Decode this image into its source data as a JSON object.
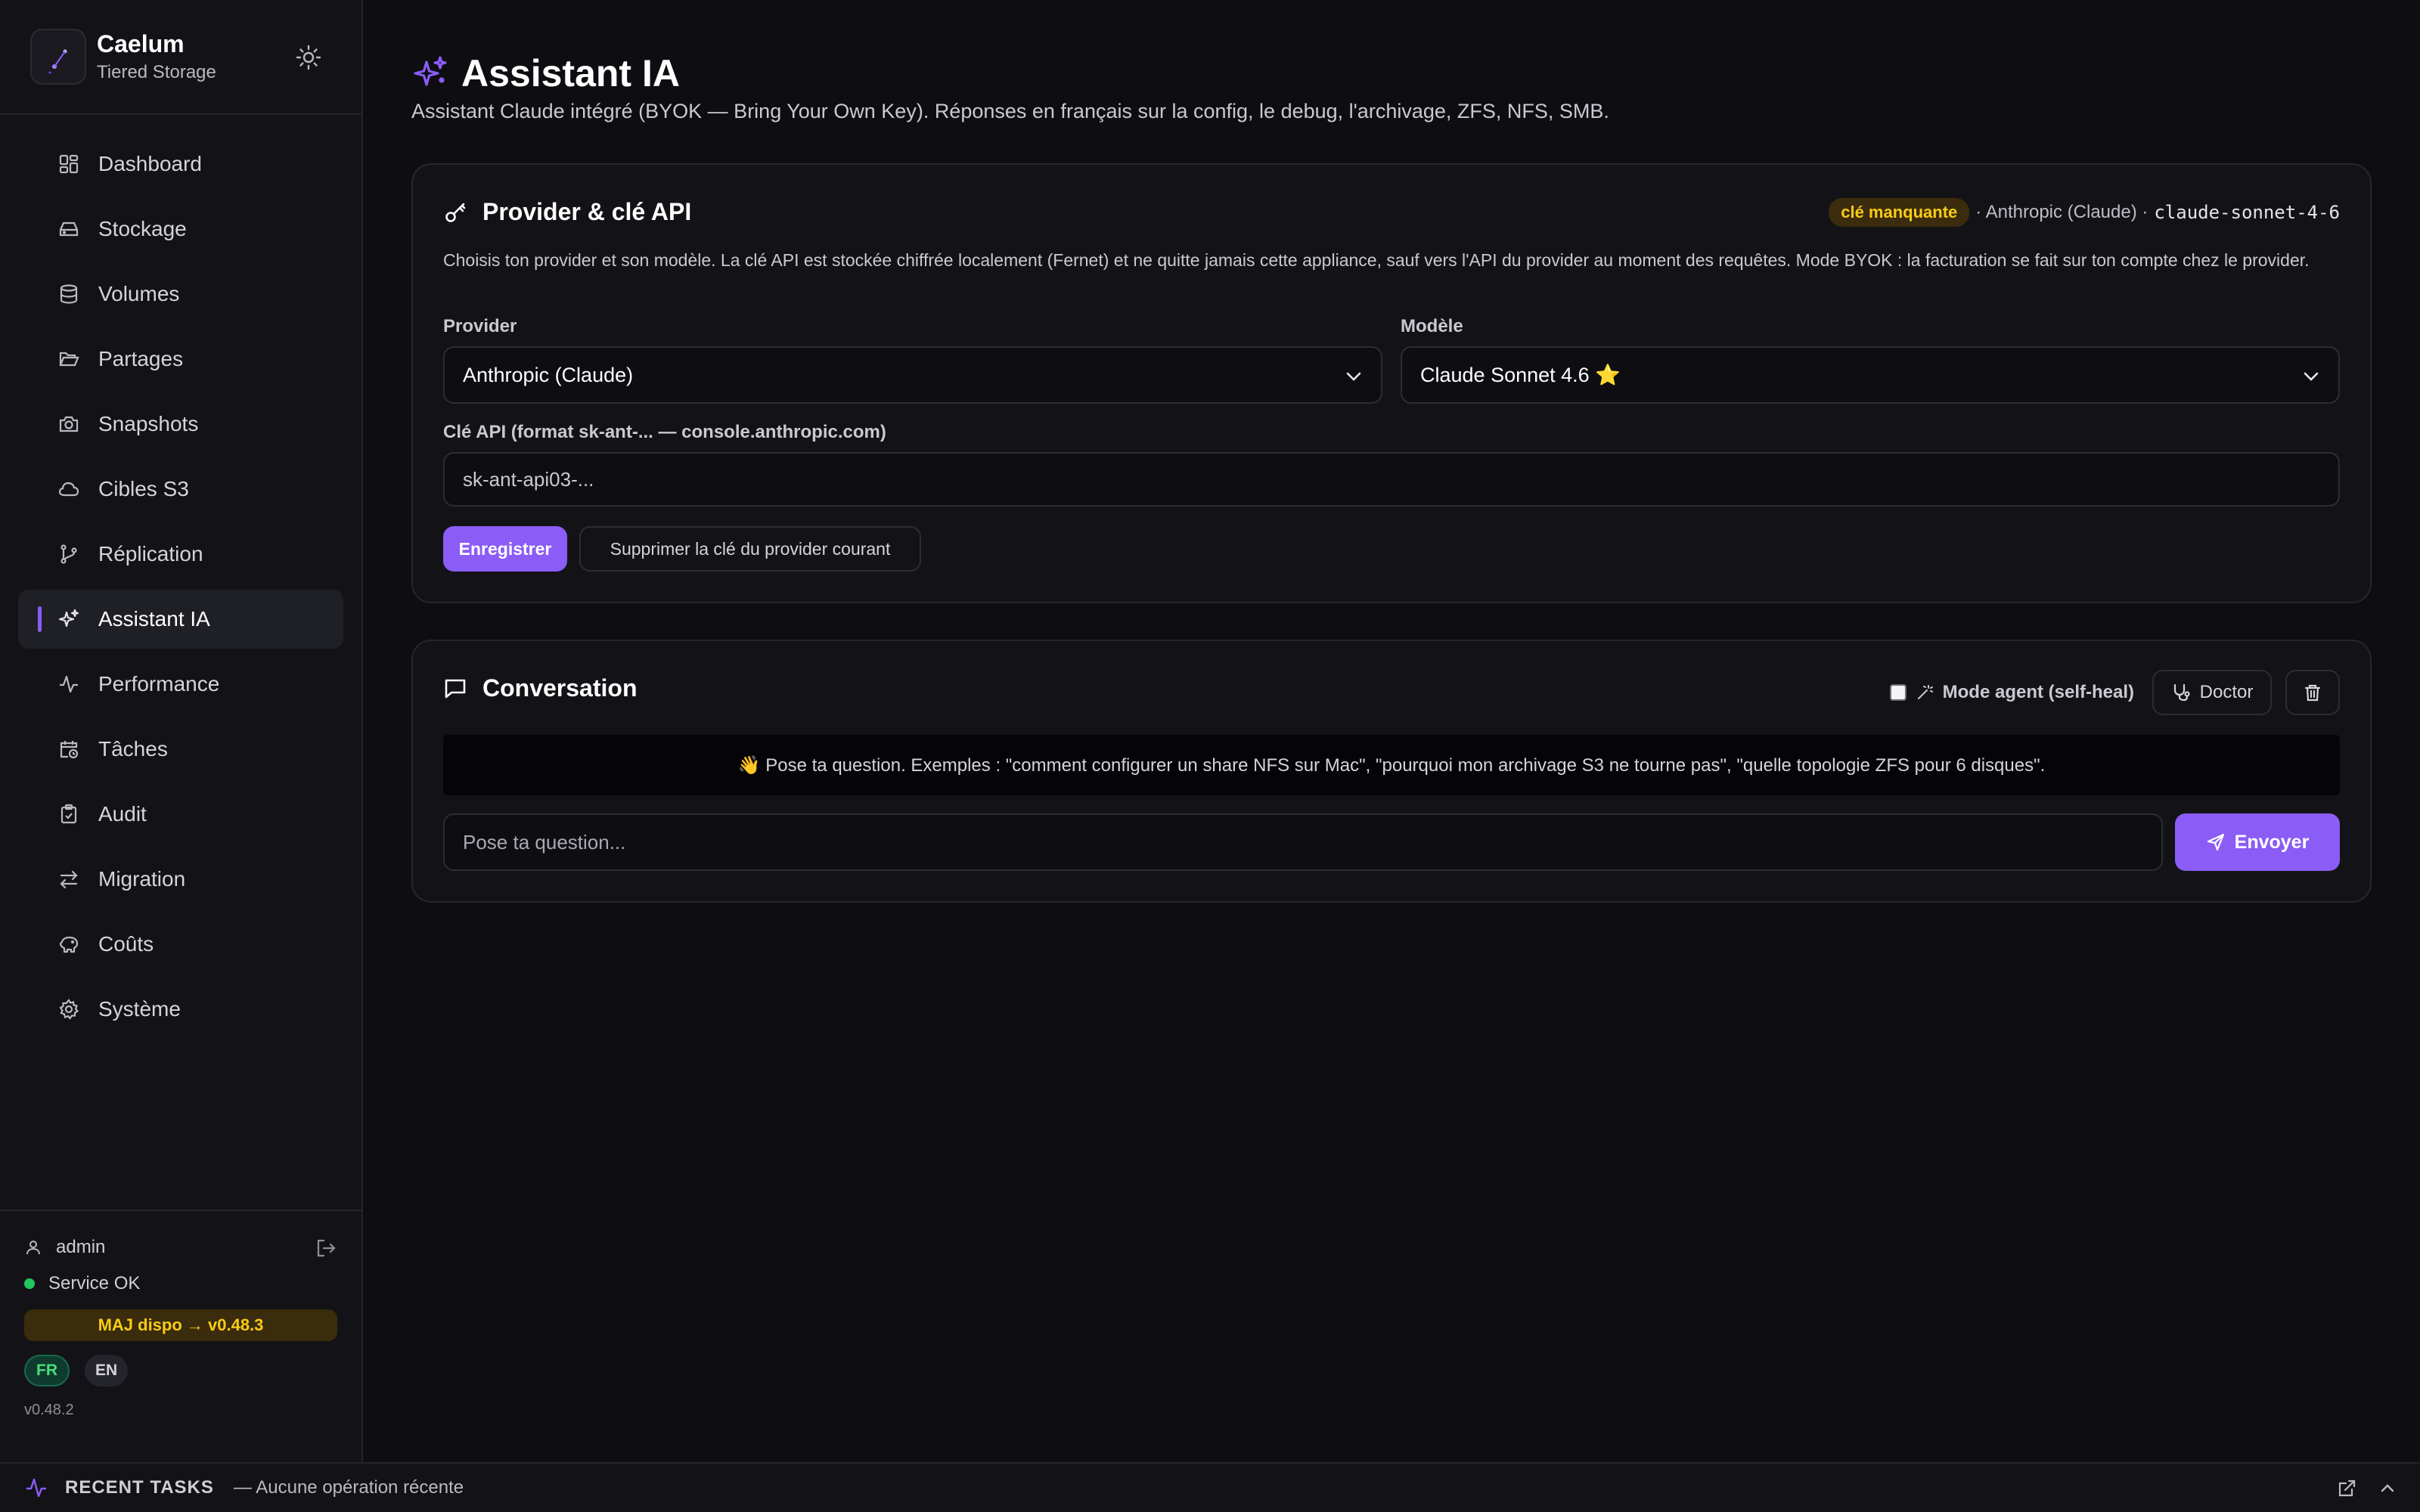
{
  "brand": {
    "name": "Caelum",
    "subtitle": "Tiered Storage"
  },
  "nav": {
    "items": [
      {
        "label": "Dashboard",
        "icon": "dashboard-icon"
      },
      {
        "label": "Stockage",
        "icon": "hard-drive-icon"
      },
      {
        "label": "Volumes",
        "icon": "database-icon"
      },
      {
        "label": "Partages",
        "icon": "folder-open-icon"
      },
      {
        "label": "Snapshots",
        "icon": "camera-icon"
      },
      {
        "label": "Cibles S3",
        "icon": "cloud-icon"
      },
      {
        "label": "Réplication",
        "icon": "git-branch-icon"
      },
      {
        "label": "Assistant IA",
        "icon": "sparkles-icon",
        "active": true
      },
      {
        "label": "Performance",
        "icon": "activity-icon"
      },
      {
        "label": "Tâches",
        "icon": "calendar-clock-icon"
      },
      {
        "label": "Audit",
        "icon": "clipboard-check-icon"
      },
      {
        "label": "Migration",
        "icon": "arrows-left-right-icon"
      },
      {
        "label": "Coûts",
        "icon": "piggy-bank-icon"
      },
      {
        "label": "Système",
        "icon": "gear-icon"
      }
    ]
  },
  "footer": {
    "user": "admin",
    "status": "Service OK",
    "update": "MAJ dispo → v0.48.3",
    "lang_fr": "FR",
    "lang_en": "EN",
    "version": "v0.48.2"
  },
  "page": {
    "title": "Assistant IA",
    "subtitle": "Assistant Claude intégré (BYOK — Bring Your Own Key). Réponses en français sur la config, le debug, l'archivage, ZFS, NFS, SMB."
  },
  "provider_card": {
    "title": "Provider & clé API",
    "badge": "clé manquante",
    "provider_meta": "· Anthropic (Claude) ·",
    "model_id": "claude-sonnet-4-6",
    "description": "Choisis ton provider et son modèle. La clé API est stockée chiffrée localement (Fernet) et ne quitte jamais cette appliance, sauf vers l'API du provider au moment des requêtes. Mode BYOK : la facturation se fait sur ton compte chez le provider.",
    "provider_label": "Provider",
    "provider_value": "Anthropic (Claude)",
    "model_label": "Modèle",
    "model_value": "Claude Sonnet 4.6 ⭐",
    "key_label": "Clé API (format sk-ant-... — console.anthropic.com)",
    "key_placeholder": "sk-ant-api03-...",
    "save_label": "Enregistrer",
    "delete_label": "Supprimer la clé du provider courant"
  },
  "conversation": {
    "title": "Conversation",
    "agent_mode_label": "Mode agent (self-heal)",
    "doctor_label": "Doctor",
    "hint": "👋 Pose ta question. Exemples : \"comment configurer un share NFS sur Mac\", \"pourquoi mon archivage S3 ne tourne pas\", \"quelle topologie ZFS pour 6 disques\".",
    "input_placeholder": "Pose ta question...",
    "send_label": "Envoyer"
  },
  "bottombar": {
    "label": "RECENT TASKS",
    "status": "— Aucune opération récente"
  },
  "colors": {
    "accent": "#8b5cf6",
    "background": "#0e0e12",
    "warning": "#facc15",
    "success": "#22c55e"
  }
}
